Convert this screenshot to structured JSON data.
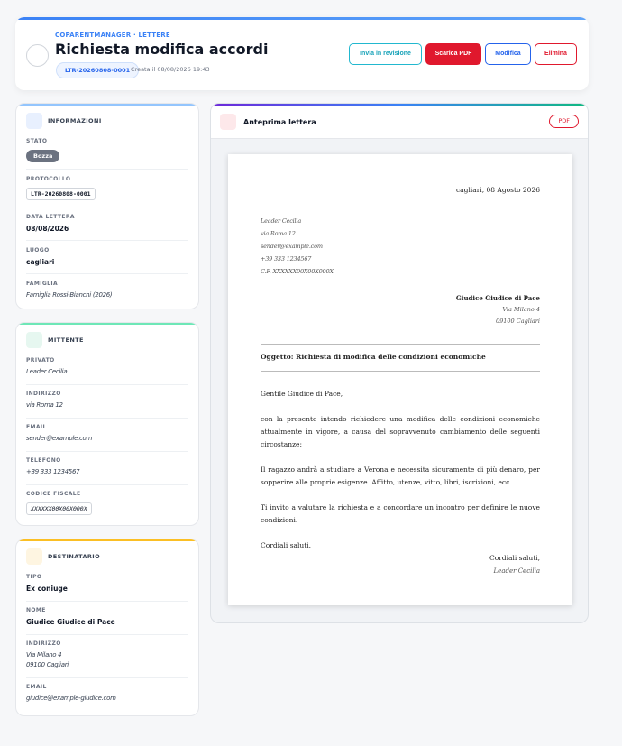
{
  "header": {
    "breadcrumb": "COPARENTMANAGER · LETTERE",
    "title": "Richiesta modifica accordi",
    "protocol": "LTR-20260808-0001",
    "created": "Creata il 08/08/2026 19:43",
    "buttons": {
      "review": "Invia in revisione",
      "pdf": "Scarica PDF",
      "edit": "Modifica",
      "delete": "Elimina"
    }
  },
  "info": {
    "title": "INFORMAZIONI",
    "status_label": "STATO",
    "status_value": "Bozza",
    "protocol_label": "PROTOCOLLO",
    "protocol_value": "LTR-20260808-0001",
    "date_label": "DATA LETTERA",
    "date_value": "08/08/2026",
    "place_label": "LUOGO",
    "place_value": "cagliari",
    "family_label": "FAMIGLIA",
    "family_value": "Famiglia Rossi-Bianchi (2026)"
  },
  "sender": {
    "title": "MITTENTE",
    "private_label": "PRIVATO",
    "private_value": "Leader Cecilia",
    "address_label": "INDIRIZZO",
    "address_value": "via Roma 12",
    "email_label": "EMAIL",
    "email_value": "sender@example.com",
    "phone_label": "TELEFONO",
    "phone_value": "+39 333 1234567",
    "tax_label": "CODICE FISCALE",
    "tax_value": "XXXXXX00X00X000X"
  },
  "recipient": {
    "title": "DESTINATARIO",
    "type_label": "TIPO",
    "type_value": "Ex coniuge",
    "name_label": "NOME",
    "name_value": "Giudice Giudice di Pace",
    "address_label": "INDIRIZZO",
    "address_line1": "Via Milano 4",
    "address_line2": "09100 Cagliari",
    "email_label": "EMAIL",
    "email_value": "giudice@example-giudice.com"
  },
  "preview": {
    "title": "Anteprima lettera",
    "badge": "PDF",
    "letter": {
      "date": "cagliari, 08 Agosto 2026",
      "sender_lines": [
        "Leader Cecilia",
        "via Roma 12",
        "sender@example.com",
        "+39 333 1234567",
        "C.F. XXXXXX00X00X000X"
      ],
      "recipient_name": "Giudice Giudice di Pace",
      "recipient_line1": "Via Milano 4",
      "recipient_line2": "09100 Cagliari",
      "subject": "Oggetto: Richiesta di modifica delle condizioni economiche",
      "greeting": "Gentile Giudice di Pace,",
      "p1": "con la presente intendo richiedere una modifica delle condizioni economiche attualmente in vigore, a causa del sopravvenuto cambiamento delle seguenti circostanze:",
      "p2": "Il ragazzo andrà a studiare a Verona e necessita sicuramente di più denaro, per sopperire alle proprie esigenze. Affitto, utenze, vitto, libri, iscrizioni, ecc....",
      "p3": "Ti invito a valutare la richiesta e a concordare un incontro per definire le nuove condizioni.",
      "regards": "Cordiali saluti.",
      "closing": "Cordiali saluti,",
      "signature": "Leader Cecilia"
    }
  },
  "colors": {
    "accent": "#3b82f6",
    "danger": "#e0182d",
    "info": "#17a2b8",
    "sender_accent": "#10b981",
    "recipient_accent": "#f59e0b"
  }
}
